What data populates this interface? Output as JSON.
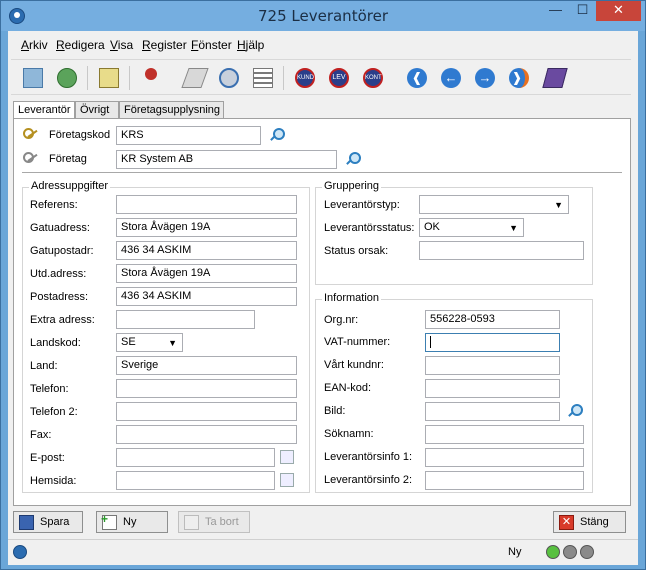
{
  "window": {
    "title": "725 Leverantörer"
  },
  "menu": [
    "Arkiv",
    "Redigera",
    "Visa",
    "Register",
    "Fönster",
    "Hjälp"
  ],
  "toolbar": {
    "buttons": [
      "KUND",
      "LEV",
      "KONT"
    ]
  },
  "tabs": [
    "Leverantör",
    "Övrigt",
    "Företagsupplysning"
  ],
  "header": {
    "foretagskod_label": "Företagskod",
    "foretagskod_value": "KRS",
    "foretag_label": "Företag",
    "foretag_value": "KR System AB"
  },
  "address": {
    "title": "Adressuppgifter",
    "fields": [
      {
        "label": "Referens:",
        "value": ""
      },
      {
        "label": "Gatuadress:",
        "value": "Stora Åvägen 19A"
      },
      {
        "label": "Gatupostadr:",
        "value": "436 34 ASKIM"
      },
      {
        "label": "Utd.adress:",
        "value": "Stora Åvägen 19A"
      },
      {
        "label": "Postadress:",
        "value": "436 34 ASKIM"
      },
      {
        "label": "Extra adress:",
        "value": ""
      },
      {
        "label": "Landskod:",
        "value": "SE"
      },
      {
        "label": "Land:",
        "value": "Sverige"
      },
      {
        "label": "Telefon:",
        "value": ""
      },
      {
        "label": "Telefon 2:",
        "value": ""
      },
      {
        "label": "Fax:",
        "value": ""
      },
      {
        "label": "E-post:",
        "value": ""
      },
      {
        "label": "Hemsida:",
        "value": ""
      }
    ]
  },
  "grouping": {
    "title": "Gruppering",
    "leverantorstyp_label": "Leverantörstyp:",
    "leverantorstyp_value": "",
    "leverantorsstatus_label": "Leverantörsstatus:",
    "leverantorsstatus_value": "OK",
    "statusorsak_label": "Status orsak:",
    "statusorsak_value": ""
  },
  "information": {
    "title": "Information",
    "fields": [
      {
        "label": "Org.nr:",
        "value": "556228-0593"
      },
      {
        "label": "VAT-nummer:",
        "value": ""
      },
      {
        "label": "Vårt kundnr:",
        "value": ""
      },
      {
        "label": "EAN-kod:",
        "value": ""
      },
      {
        "label": "Bild:",
        "value": ""
      },
      {
        "label": "Söknamn:",
        "value": ""
      },
      {
        "label": "Leverantörsinfo 1:",
        "value": ""
      },
      {
        "label": "Leverantörsinfo 2:",
        "value": ""
      }
    ]
  },
  "buttons": {
    "save": "Spara",
    "new": "Ny",
    "delete": "Ta bort",
    "close": "Stäng"
  },
  "status": {
    "mode": "Ny"
  }
}
